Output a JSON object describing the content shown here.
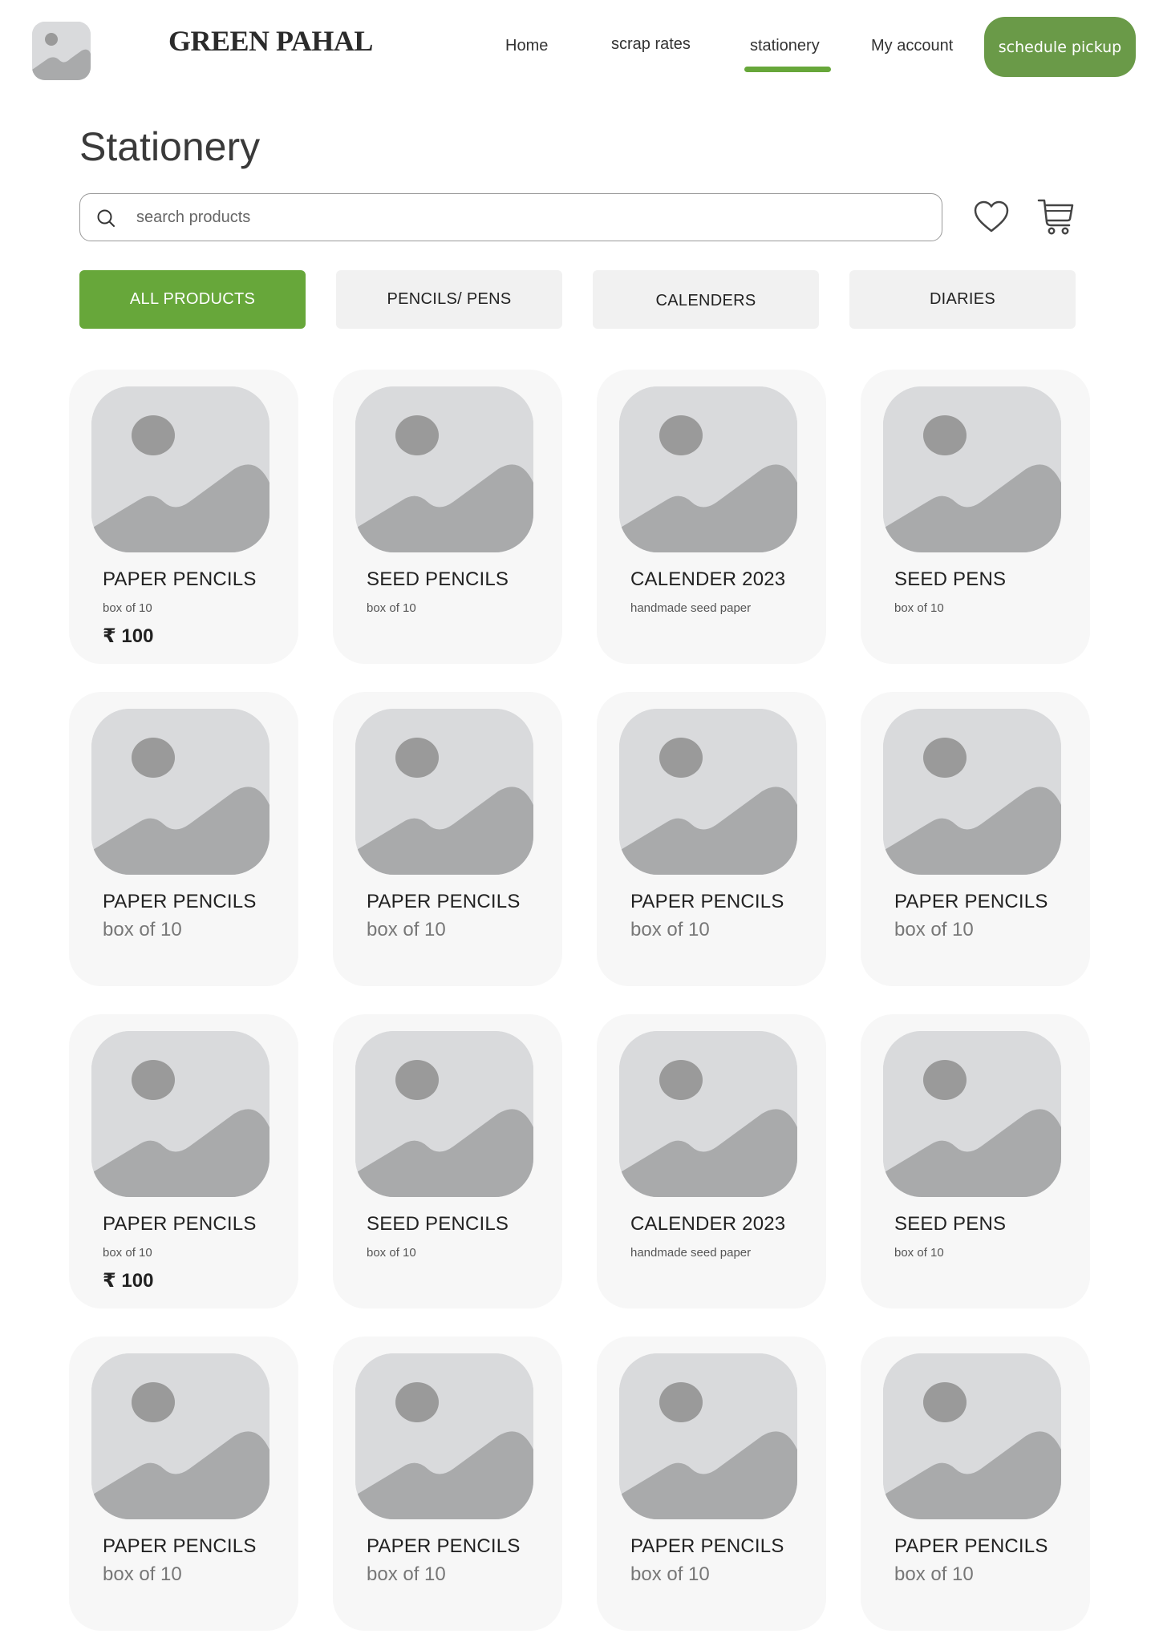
{
  "header": {
    "brand": "GREEN PAHAL",
    "nav": [
      {
        "label": "Home"
      },
      {
        "label": "scrap rates"
      },
      {
        "label": "stationery"
      },
      {
        "label": "My account"
      }
    ],
    "active_nav": "stationery",
    "pickup_label": "schedule pickup",
    "accent_color": "#67a73a",
    "pickup_color": "#6a9a48"
  },
  "page": {
    "title": "Stationery"
  },
  "search": {
    "placeholder": "search products",
    "value": ""
  },
  "icons": {
    "search": "search-icon",
    "wishlist": "heart-icon",
    "cart": "cart-icon"
  },
  "tabs": [
    {
      "label": "ALL PRODUCTS",
      "active": true
    },
    {
      "label": "PENCILS/ PENS",
      "active": false
    },
    {
      "label": "CALENDERS",
      "active": false
    },
    {
      "label": "DIARIES",
      "active": false
    }
  ],
  "products": [
    {
      "title": "PAPER PENCILS",
      "subtitle": "box of 10",
      "price": "₹ 100",
      "style": "small"
    },
    {
      "title": "SEED PENCILS",
      "subtitle": "box of 10",
      "price": "",
      "style": "small"
    },
    {
      "title": "CALENDER 2023",
      "subtitle": "handmade seed paper",
      "price": "",
      "style": "small"
    },
    {
      "title": "SEED PENS",
      "subtitle": "box of 10",
      "price": "",
      "style": "small"
    },
    {
      "title": "PAPER PENCILS",
      "subtitle": "box of 10",
      "price": "",
      "style": "large"
    },
    {
      "title": "PAPER PENCILS",
      "subtitle": "box of 10",
      "price": "",
      "style": "large"
    },
    {
      "title": "PAPER PENCILS",
      "subtitle": "box of 10",
      "price": "",
      "style": "large"
    },
    {
      "title": "PAPER PENCILS",
      "subtitle": "box of 10",
      "price": "",
      "style": "large"
    },
    {
      "title": "PAPER PENCILS",
      "subtitle": "box of 10",
      "price": "₹ 100",
      "style": "small"
    },
    {
      "title": "SEED PENCILS",
      "subtitle": "box of 10",
      "price": "",
      "style": "small"
    },
    {
      "title": "CALENDER 2023",
      "subtitle": "handmade seed paper",
      "price": "",
      "style": "small"
    },
    {
      "title": "SEED PENS",
      "subtitle": "box of 10",
      "price": "",
      "style": "small"
    },
    {
      "title": "PAPER PENCILS",
      "subtitle": "box of 10",
      "price": "",
      "style": "large"
    },
    {
      "title": "PAPER PENCILS",
      "subtitle": "box of 10",
      "price": "",
      "style": "large"
    },
    {
      "title": "PAPER PENCILS",
      "subtitle": "box of 10",
      "price": "",
      "style": "large"
    },
    {
      "title": "PAPER PENCILS",
      "subtitle": "box of 10",
      "price": "",
      "style": "large"
    }
  ]
}
